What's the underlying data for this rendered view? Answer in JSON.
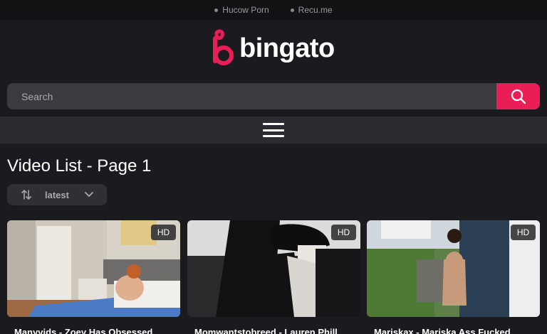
{
  "top_links": [
    {
      "label": "Hucow Porn"
    },
    {
      "label": "Recu.me"
    }
  ],
  "logo": {
    "text": "bingato",
    "brand_color": "#e91e57"
  },
  "search": {
    "placeholder": "Search",
    "value": ""
  },
  "menu": {
    "icon": "hamburger-menu-icon"
  },
  "page": {
    "title": "Video List - Page 1"
  },
  "sort": {
    "selected": "latest"
  },
  "videos": [
    {
      "badge": "HD",
      "title": "Manyvids - Zoey Has Obsessed"
    },
    {
      "badge": "HD",
      "title": "Momwantstobreed - Lauren Phill"
    },
    {
      "badge": "HD",
      "title": "Mariskax - Mariska Ass Fucked"
    }
  ]
}
